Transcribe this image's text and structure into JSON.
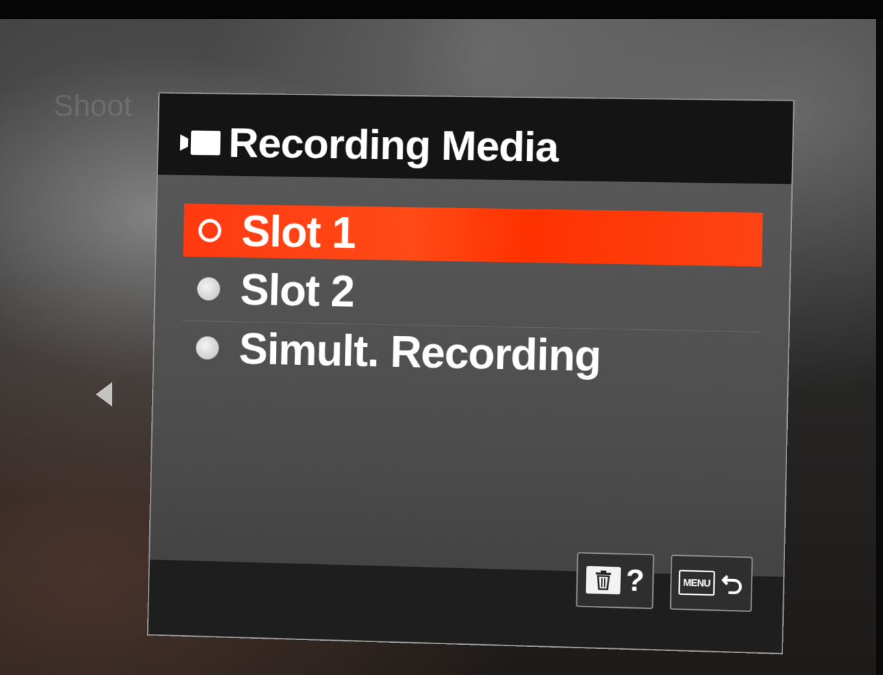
{
  "screen": {
    "background_ghost_title": "Shoot"
  },
  "dialog": {
    "title": "Recording Media",
    "title_icon": "movie-camera-icon",
    "options": [
      {
        "label": "Slot 1",
        "selected": true
      },
      {
        "label": "Slot 2",
        "selected": false
      },
      {
        "label": "Simult. Recording",
        "selected": false
      }
    ]
  },
  "footer": {
    "delete_help_icon": "trash-icon",
    "help_label": "?",
    "menu_label": "MENU",
    "back_icon": "return-arrow-icon"
  },
  "colors": {
    "highlight": "#ff3a10",
    "header_bg": "#141414",
    "panel_bg": "#565656"
  }
}
